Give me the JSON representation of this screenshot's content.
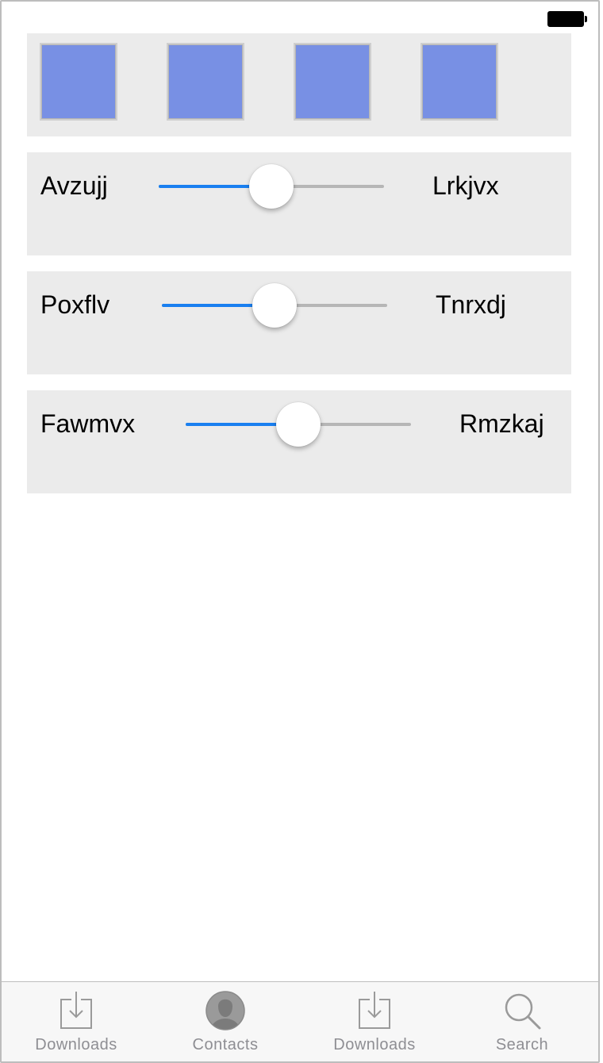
{
  "status_bar": {
    "battery_icon": "battery-full-icon"
  },
  "swatches": [
    {
      "color": "#7890e4"
    },
    {
      "color": "#7890e4"
    },
    {
      "color": "#7890e4"
    },
    {
      "color": "#7890e4"
    }
  ],
  "sliders": [
    {
      "left_label": "Avzujj",
      "right_label": "Lrkjvx",
      "value": 0.5
    },
    {
      "left_label": "Poxflv",
      "right_label": "Tnrxdj",
      "value": 0.5
    },
    {
      "left_label": "Fawmvx",
      "right_label": "Rmzkaj",
      "value": 0.5
    }
  ],
  "colors": {
    "accent": "#1a7ff0",
    "panel_bg": "#ebebeb",
    "swatch": "#7890e4",
    "tab_inactive": "#8e8e93"
  },
  "tab_bar": {
    "tabs": [
      {
        "label": "Downloads",
        "icon": "download-icon"
      },
      {
        "label": "Contacts",
        "icon": "contact-icon"
      },
      {
        "label": "Downloads",
        "icon": "download-icon"
      },
      {
        "label": "Search",
        "icon": "search-icon"
      }
    ]
  }
}
